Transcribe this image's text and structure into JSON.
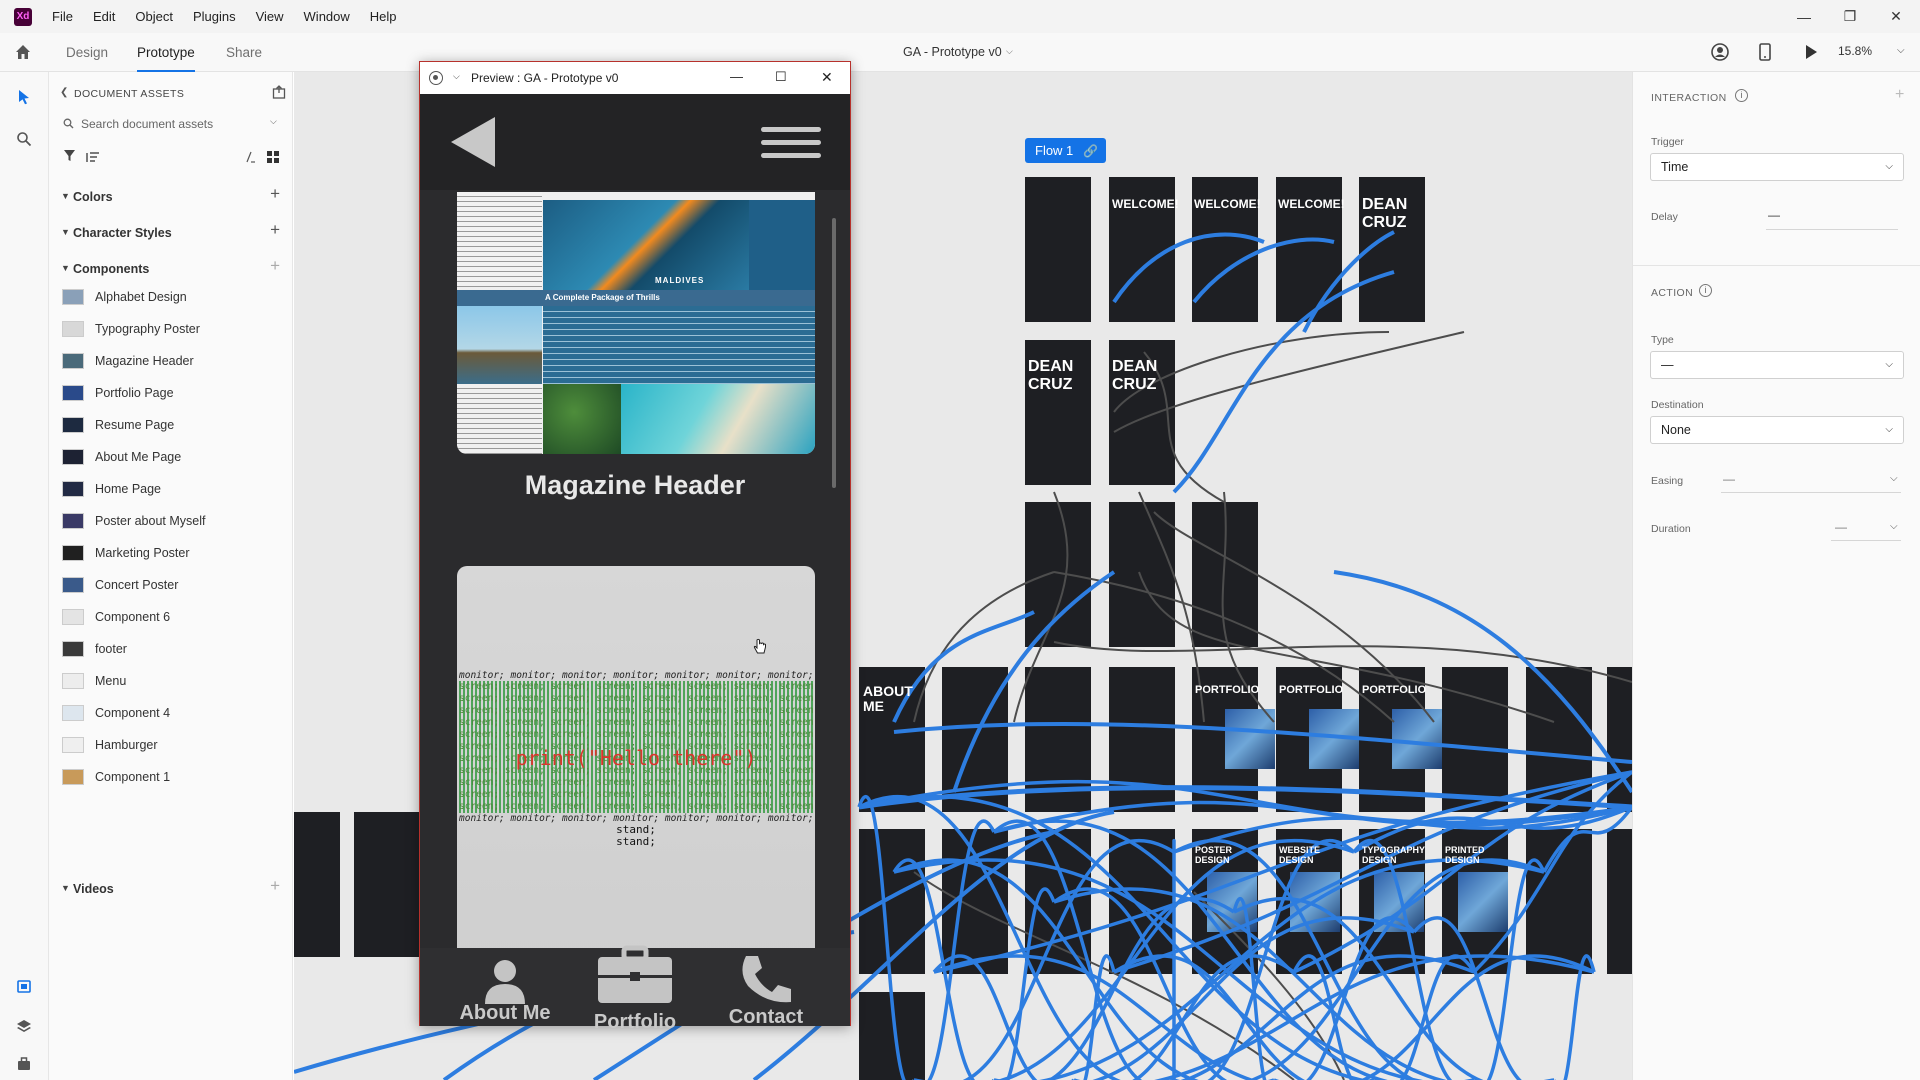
{
  "menubar": {
    "logo": "Xd",
    "items": [
      "File",
      "Edit",
      "Object",
      "Plugins",
      "View",
      "Window",
      "Help"
    ]
  },
  "toolbar": {
    "tabs": [
      "Design",
      "Prototype",
      "Share"
    ],
    "active_tab": "Prototype",
    "doc_title": "GA - Prototype v0",
    "zoom": "15.8%"
  },
  "assets": {
    "header": "DOCUMENT ASSETS",
    "search_placeholder": "Search document assets",
    "sections": {
      "colors": "Colors",
      "character_styles": "Character Styles",
      "components": "Components",
      "videos": "Videos"
    },
    "components": [
      {
        "label": "Alphabet Design",
        "thumb": "#8aa0b8"
      },
      {
        "label": "Typography Poster",
        "thumb": "#d8d8d8"
      },
      {
        "label": "Magazine Header",
        "thumb": "#4a6a7a"
      },
      {
        "label": "Portfolio Page",
        "thumb": "#2a4a8a"
      },
      {
        "label": "Resume Page",
        "thumb": "#1d2a40"
      },
      {
        "label": "About Me Page",
        "thumb": "#1d2233"
      },
      {
        "label": "Home Page",
        "thumb": "#222a44"
      },
      {
        "label": "Poster about Myself",
        "thumb": "#3a3a66"
      },
      {
        "label": "Marketing Poster",
        "thumb": "#202020"
      },
      {
        "label": "Concert Poster",
        "thumb": "#3a5a8a"
      },
      {
        "label": "Component 6",
        "thumb": "#e4e4e4"
      },
      {
        "label": "footer",
        "thumb": "#3a3a3a"
      },
      {
        "label": "Menu",
        "thumb": "#ededed"
      },
      {
        "label": "Component 4",
        "thumb": "#dde6ee"
      },
      {
        "label": "Hamburger",
        "thumb": "#efefef"
      },
      {
        "label": "Component 1",
        "thumb": "#c89a5a"
      }
    ]
  },
  "canvas": {
    "flow_label": "Flow 1",
    "boards": {
      "welcome1": "WELCOME!",
      "welcome2": "WELCOME!",
      "welcome3": "WELCOME!",
      "dean_cruz": "DEAN CRUZ",
      "about_me": "ABOUT ME",
      "portfolio": "PORTFOLIO",
      "poster_design": "POSTER DESIGN",
      "website_design": "WEBSITE DESIGN",
      "typography_design": "TYPOGRAPHY DESIGN",
      "printed_design": "PRINTED DESIGN"
    }
  },
  "preview": {
    "title": "Preview : GA - Prototype v0",
    "magazine_caption": "Magazine Header",
    "magazine_subhead": "A Complete Package of Thrills",
    "magazine_dest": "MALDIVES",
    "code_keyword": "monitor;",
    "code_word": "screen",
    "code_text": "print(\"Hello there\")",
    "code_stand": "stand;",
    "footer": [
      "About Me",
      "Portfolio",
      "Contact"
    ]
  },
  "right_panel": {
    "interaction_header": "INTERACTION",
    "trigger_label": "Trigger",
    "trigger_value": "Time",
    "delay_label": "Delay",
    "delay_value": "—",
    "action_header": "ACTION",
    "type_label": "Type",
    "type_value": "—",
    "destination_label": "Destination",
    "destination_value": "None",
    "easing_label": "Easing",
    "easing_value": "—",
    "duration_label": "Duration",
    "duration_value": "—"
  },
  "colors": {
    "accent": "#1473e6",
    "wire": "#2d7de0",
    "artboard": "#1e1f23",
    "preview_border": "#b7312c"
  }
}
